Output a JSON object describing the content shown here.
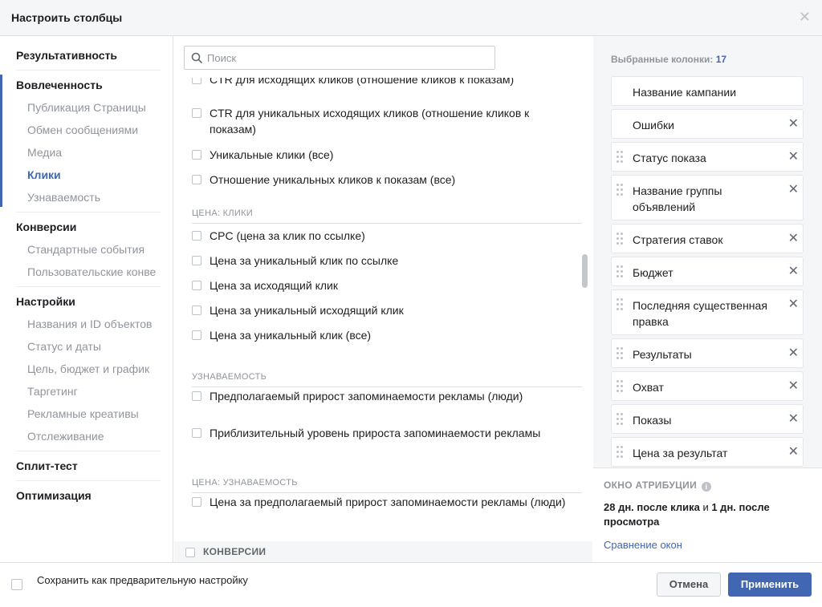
{
  "dialog": {
    "title": "Настроить столбцы"
  },
  "nav": {
    "groups": [
      {
        "label": "Результативность",
        "items": []
      },
      {
        "label": "Вовлеченность",
        "items": [
          "Публикация Страницы",
          "Обмен сообщениями",
          "Медиа",
          "Клики",
          "Узнаваемость"
        ],
        "active_item": "Клики"
      },
      {
        "label": "Конверсии",
        "items": [
          "Стандартные события",
          "Пользовательские конве"
        ]
      },
      {
        "label": "Настройки",
        "items": [
          "Названия и ID объектов",
          "Статус и даты",
          "Цель, бюджет и график",
          "Таргетинг",
          "Рекламные креативы",
          "Отслеживание"
        ]
      },
      {
        "label": "Сплит-тест",
        "items": []
      },
      {
        "label": "Оптимизация",
        "items": []
      }
    ]
  },
  "search": {
    "placeholder": "Поиск",
    "value": ""
  },
  "list": {
    "clicks_items": [
      "CTR для исходящих кликов (отношение кликов к показам)",
      "CTR для уникальных исходящих кликов (отношение кликов к показам)",
      "Уникальные клики (все)",
      "Отношение уникальных кликов к показам (все)"
    ],
    "sections": [
      {
        "title": "ЦЕНА: КЛИКИ",
        "items": [
          "CPC (цена за клик по ссылке)",
          "Цена за уникальный клик по ссылке",
          "Цена за исходящий клик",
          "Цена за уникальный исходящий клик",
          "Цена за уникальный клик (все)"
        ]
      },
      {
        "title": "УЗНАВАЕМОСТЬ",
        "items": [
          "Предполагаемый прирост запоминаемости рекламы (люди)",
          "Приблизительный уровень прироста запоминаемости рекламы"
        ]
      },
      {
        "title": "ЦЕНА: УЗНАВАЕМОСТЬ",
        "items": [
          "Цена за предполагаемый прирост запоминаемости рекламы (люди)"
        ]
      }
    ],
    "next_group": "КОНВЕРСИИ"
  },
  "selected": {
    "label": "Выбранные колонки:",
    "count": "17",
    "columns": [
      {
        "label": "Название кампании",
        "removable": false,
        "draggable": false
      },
      {
        "label": "Ошибки",
        "removable": true,
        "draggable": false
      },
      {
        "label": "Статус показа",
        "removable": true,
        "draggable": true
      },
      {
        "label": "Название группы объявлений",
        "removable": true,
        "draggable": true
      },
      {
        "label": "Стратегия ставок",
        "removable": true,
        "draggable": true
      },
      {
        "label": "Бюджет",
        "removable": true,
        "draggable": true
      },
      {
        "label": "Последняя существенная правка",
        "removable": true,
        "draggable": true
      },
      {
        "label": "Результаты",
        "removable": true,
        "draggable": true
      },
      {
        "label": "Охват",
        "removable": true,
        "draggable": true
      },
      {
        "label": "Показы",
        "removable": true,
        "draggable": true
      },
      {
        "label": "Цена за результат",
        "removable": true,
        "draggable": true
      }
    ]
  },
  "attribution": {
    "title": "ОКНО АТРИБУЦИИ",
    "click_part": "28 дн. после клика",
    "and": " и ",
    "view_part": "1 дн. после просмотра",
    "link": "Сравнение окон"
  },
  "footer": {
    "save_preset_label": "Сохранить как предварительную настройку",
    "cancel_label": "Отмена",
    "apply_label": "Применить"
  },
  "colors": {
    "accent": "#4267b2",
    "muted": "#90949c"
  }
}
